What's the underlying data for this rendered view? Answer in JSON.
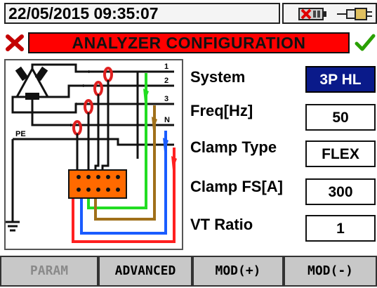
{
  "status_bar": {
    "datetime": "22/05/2015 09:35:07",
    "icons": [
      "battery-missing-icon",
      "plug-icon"
    ]
  },
  "title_bar": {
    "title": "ANALYZER CONFIGURATION",
    "title_bg": "#ff0000",
    "left_icon": "cancel-x-icon",
    "right_icon": "confirm-check-icon"
  },
  "diagram": {
    "terminals": [
      "1",
      "2",
      "3",
      "N"
    ],
    "ground_label": "PE"
  },
  "params": [
    {
      "label": "System",
      "value": "3P HL",
      "selected": true
    },
    {
      "label": "Freq[Hz]",
      "value": "50",
      "selected": false
    },
    {
      "label": "Clamp Type",
      "value": "FLEX",
      "selected": false
    },
    {
      "label": "Clamp FS[A]",
      "value": "300",
      "selected": false
    },
    {
      "label": "VT Ratio",
      "value": "1",
      "selected": false
    }
  ],
  "buttons": [
    {
      "label": "PARAM",
      "enabled": false
    },
    {
      "label": "ADVANCED",
      "enabled": true
    },
    {
      "label": "MOD(+)",
      "enabled": true
    },
    {
      "label": "MOD(-)",
      "enabled": true
    }
  ],
  "colors": {
    "selected_bg": "#0a1a8a",
    "title_bg": "#ff0000",
    "button_bg": "#c8c8c8",
    "probe_red": "#e02020",
    "wire_blue": "#1a5cff",
    "wire_brown": "#a0701a",
    "wire_green": "#22dd22",
    "wire_red": "#ff2020",
    "meter_orange": "#ff6a00"
  }
}
